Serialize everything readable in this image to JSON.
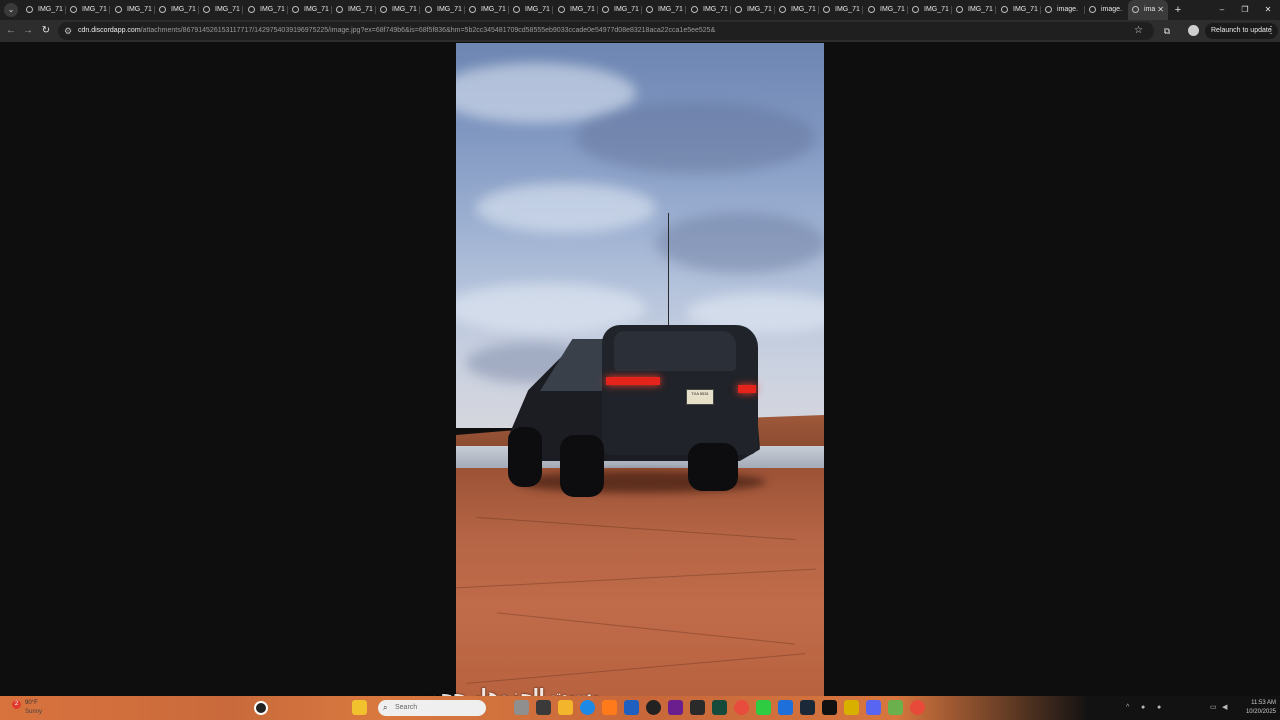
{
  "tabs": {
    "items": [
      {
        "label": "IMG_71"
      },
      {
        "label": "IMG_71"
      },
      {
        "label": "IMG_71"
      },
      {
        "label": "IMG_71"
      },
      {
        "label": "IMG_71"
      },
      {
        "label": "IMG_71"
      },
      {
        "label": "IMG_71"
      },
      {
        "label": "IMG_71"
      },
      {
        "label": "IMG_71"
      },
      {
        "label": "IMG_71"
      },
      {
        "label": "IMG_71"
      },
      {
        "label": "IMG_71"
      },
      {
        "label": "IMG_71"
      },
      {
        "label": "IMG_71"
      },
      {
        "label": "IMG_71"
      },
      {
        "label": "IMG_71"
      },
      {
        "label": "IMG_71"
      },
      {
        "label": "IMG_71"
      },
      {
        "label": "IMG_71"
      },
      {
        "label": "IMG_71"
      },
      {
        "label": "IMG_71"
      },
      {
        "label": "IMG_71"
      },
      {
        "label": "IMG_71"
      },
      {
        "label": "image."
      },
      {
        "label": "image."
      }
    ],
    "active_label": "ima",
    "new_tab_label": "+"
  },
  "window": {
    "minimize": "–",
    "restore": "❐",
    "close": "✕"
  },
  "toolbar": {
    "back": "←",
    "forward": "→",
    "reload": "↻",
    "url_host": "cdn.discordapp.com",
    "url_path": "/attachments/867914526153117717/1429754039196975225/image.jpg?ex=68f749b6&is=68f5f836&hm=5b2cc345481709cd58555eb9033ccade0e54977d08e83218aca22cca1e5ee525&",
    "bookmark_star": "☆",
    "relaunch_label": "Relaunch to update",
    "menu": "⋮"
  },
  "viewer": {
    "plate_text": "TXA 5531",
    "caption": "بسبت الجزوهار حجمي"
  },
  "taskbar": {
    "weather_badge": "2",
    "weather_temp": "90°F",
    "weather_cond": "Sunny",
    "search_placeholder": "Search",
    "tray_chevron": "^",
    "clock_time": "11:53 AM",
    "clock_date": "10/20/2025"
  }
}
